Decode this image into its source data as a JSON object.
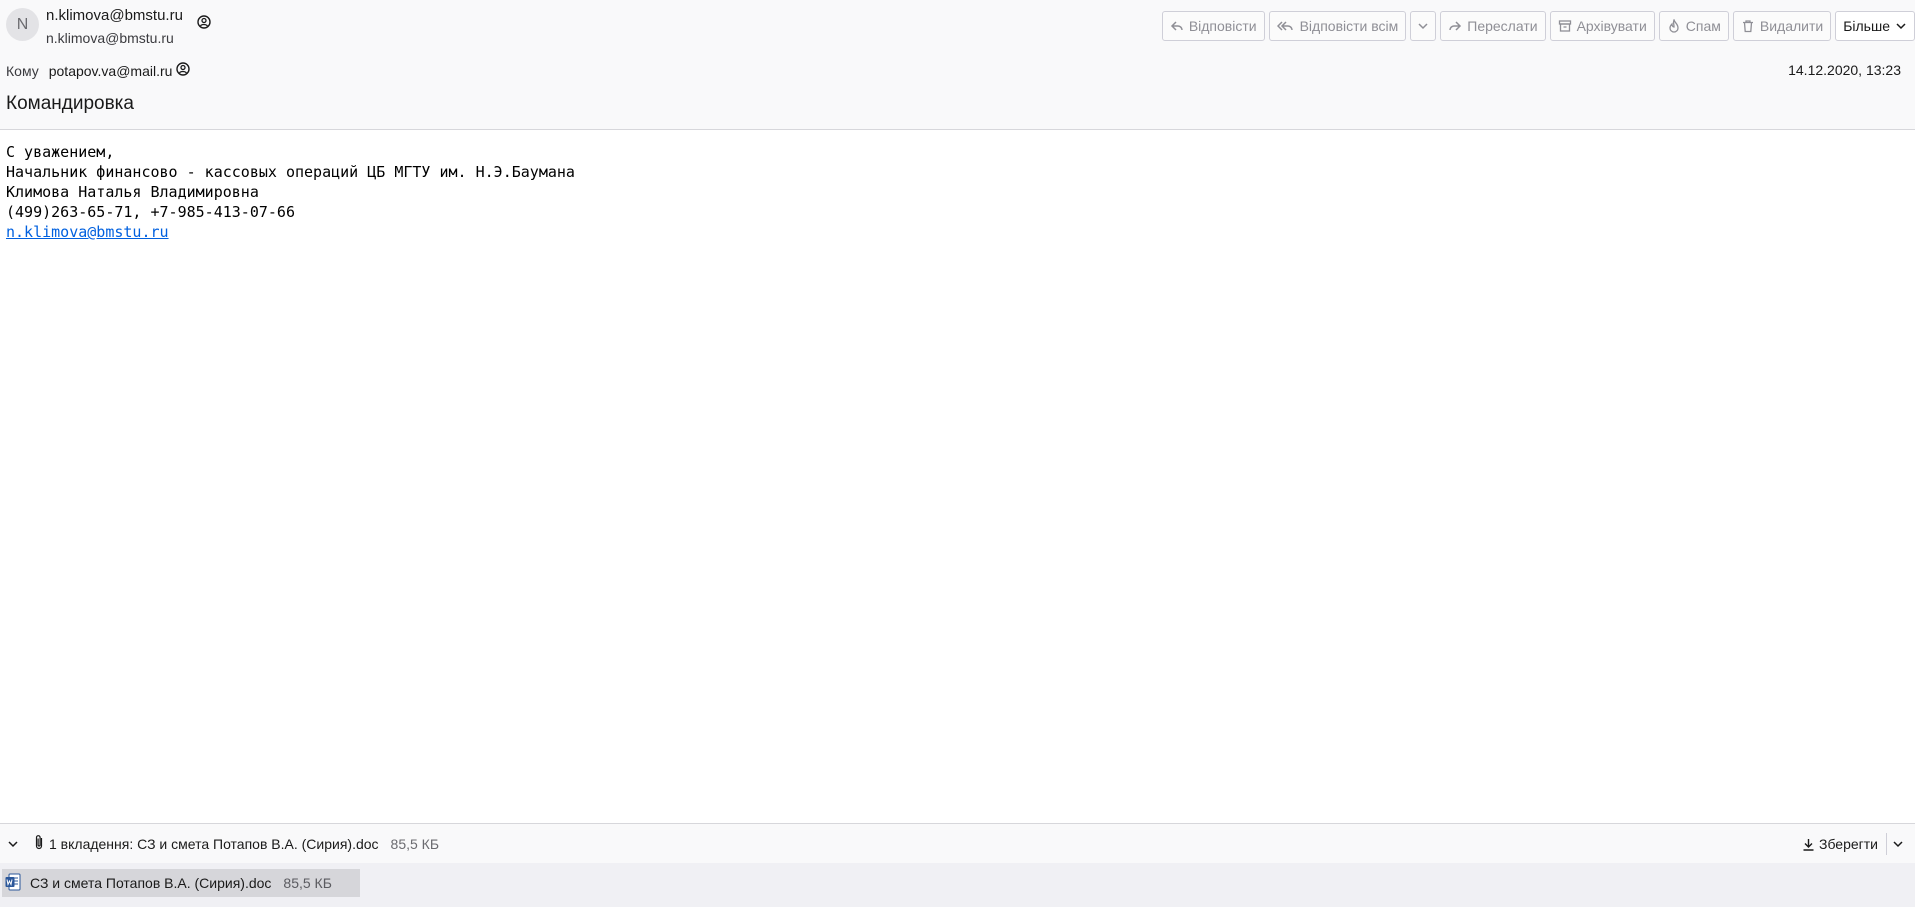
{
  "header": {
    "avatar_letter": "N",
    "from_name": "n.klimova@bmstu.ru",
    "from_address": "n.klimova@bmstu.ru",
    "to_label": "Кому",
    "to_address": "potapov.va@mail.ru",
    "date": "14.12.2020, 13:23",
    "subject": "Командировка"
  },
  "toolbar": {
    "reply": "Відповісти",
    "reply_all": "Відповісти всім",
    "forward": "Переслати",
    "archive": "Архівувати",
    "spam": "Спам",
    "delete": "Видалити",
    "more": "Більше"
  },
  "body": {
    "lines": [
      "С уважением,",
      "Начальник финансово - кассовых операций ЦБ МГТУ им. Н.Э.Баумана",
      "Климова Наталья Владимировна",
      "(499)263-65-71, +7-985-413-07-66"
    ],
    "link": "n.klimova@bmstu.ru"
  },
  "attachments": {
    "summary": "1 вкладення: СЗ и смета Потапов В.А. (Сирия).doc",
    "total_size": "85,5 КБ",
    "save_label": "Зберегти",
    "items": [
      {
        "name": "СЗ и смета Потапов В.А. (Сирия).doc",
        "size": "85,5 КБ",
        "icon": "word-doc-icon"
      }
    ]
  },
  "colors": {
    "link": "#0060df",
    "header_bg": "#f9f9fa",
    "disabled_text": "#8f8f96",
    "word_blue": "#2b579a"
  }
}
